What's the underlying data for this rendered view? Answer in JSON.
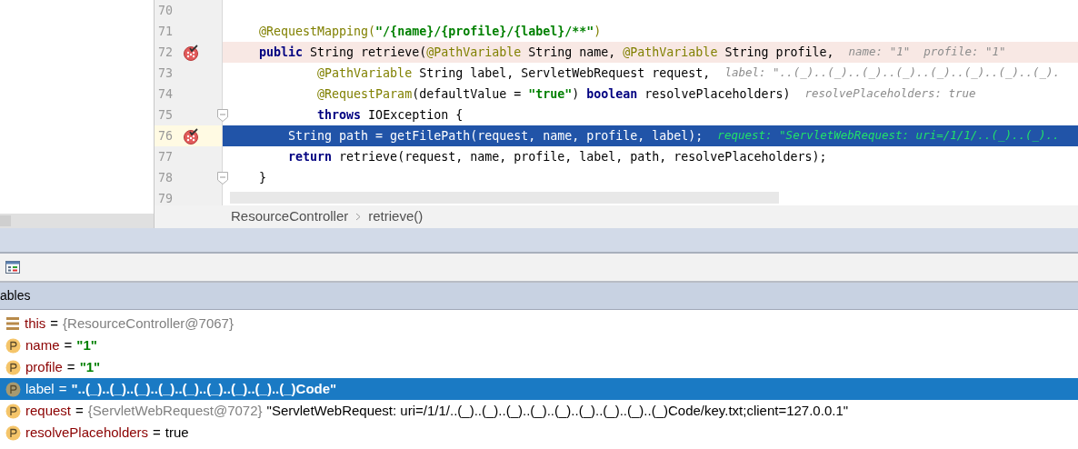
{
  "editor": {
    "lines": [
      {
        "number": "70",
        "breakpoint": false,
        "current": false,
        "fold": false
      },
      {
        "number": "71",
        "breakpoint": false,
        "current": false,
        "fold": false,
        "tokens": [
          {
            "kind": "annotation",
            "text": "    @RequestMapping("
          },
          {
            "kind": "string",
            "text": "\"/{name}/{profile}/{label}/**\""
          },
          {
            "kind": "annotation",
            "text": ")"
          }
        ]
      },
      {
        "number": "72",
        "breakpoint": true,
        "current": false,
        "fold": false,
        "tokens": [
          {
            "kind": "keyword",
            "text": "    public"
          },
          {
            "kind": "plain",
            "text": " String retrieve("
          },
          {
            "kind": "annotation",
            "text": "@PathVariable"
          },
          {
            "kind": "plain",
            "text": " String name, "
          },
          {
            "kind": "annotation",
            "text": "@PathVariable"
          },
          {
            "kind": "plain",
            "text": " String profile,"
          }
        ],
        "hint": "name: \"1\"  profile: \"1\""
      },
      {
        "number": "73",
        "breakpoint": false,
        "current": false,
        "fold": false,
        "tokens": [
          {
            "kind": "annotation",
            "text": "            @PathVariable"
          },
          {
            "kind": "plain",
            "text": " String label, ServletWebRequest request,"
          }
        ],
        "hint": "label: \"..(_)..(_)..(_)..(_)..(_)..(_)..(_)..(_)."
      },
      {
        "number": "74",
        "breakpoint": false,
        "current": false,
        "fold": false,
        "tokens": [
          {
            "kind": "annotation",
            "text": "            @RequestParam"
          },
          {
            "kind": "plain",
            "text": "(defaultValue = "
          },
          {
            "kind": "string",
            "text": "\"true\""
          },
          {
            "kind": "plain",
            "text": ") "
          },
          {
            "kind": "keyword",
            "text": "boolean"
          },
          {
            "kind": "plain",
            "text": " resolvePlaceholders)"
          }
        ],
        "hint": "resolvePlaceholders: true"
      },
      {
        "number": "75",
        "breakpoint": false,
        "current": false,
        "fold": true,
        "tokens": [
          {
            "kind": "keyword",
            "text": "            throws"
          },
          {
            "kind": "plain",
            "text": " IOException {"
          }
        ]
      },
      {
        "number": "76",
        "breakpoint": true,
        "current": true,
        "fold": false,
        "tokens": [
          {
            "kind": "plain",
            "text": "        String path = getFilePath(request, name, profile, label);"
          }
        ],
        "hint": "request: \"ServletWebRequest: uri=/1/1/..(_)..(_).."
      },
      {
        "number": "77",
        "breakpoint": false,
        "current": false,
        "fold": false,
        "tokens": [
          {
            "kind": "keyword",
            "text": "        return"
          },
          {
            "kind": "plain",
            "text": " retrieve(request, name, profile, label, path, resolvePlaceholders);"
          }
        ]
      },
      {
        "number": "78",
        "breakpoint": false,
        "current": false,
        "fold": true,
        "tokens": [
          {
            "kind": "plain",
            "text": "    }"
          }
        ]
      },
      {
        "number": "79",
        "breakpoint": false,
        "current": false,
        "fold": false
      }
    ]
  },
  "breadcrumb": [
    "ResourceController",
    "retrieve()"
  ],
  "variables_panel": {
    "title": "ables",
    "rows": [
      {
        "kind": "field",
        "name": "this",
        "operator": "=",
        "ref": "{ResourceController@7067}",
        "selected": false
      },
      {
        "kind": "param",
        "name": "name",
        "operator": "=",
        "value": "\"1\"",
        "quoted": true,
        "selected": false
      },
      {
        "kind": "param",
        "name": "profile",
        "operator": "=",
        "value": "\"1\"",
        "quoted": true,
        "selected": false
      },
      {
        "kind": "param",
        "name": "label",
        "operator": "=",
        "value": "\"..(_)..(_)..(_)..(_)..(_)..(_)..(_)..(_)..(_)Code\"",
        "quoted": true,
        "selected": true
      },
      {
        "kind": "param",
        "name": "request",
        "operator": "=",
        "ref": "{ServletWebRequest@7072}",
        "value": "\"ServletWebRequest: uri=/1/1/..(_)..(_)..(_)..(_)..(_)..(_)..(_)..(_)..(_)Code/key.txt;client=127.0.0.1\"",
        "quoted": false,
        "selected": false
      },
      {
        "kind": "param",
        "name": "resolvePlaceholders",
        "operator": "=",
        "value": "true",
        "quoted": false,
        "selected": false
      }
    ]
  }
}
